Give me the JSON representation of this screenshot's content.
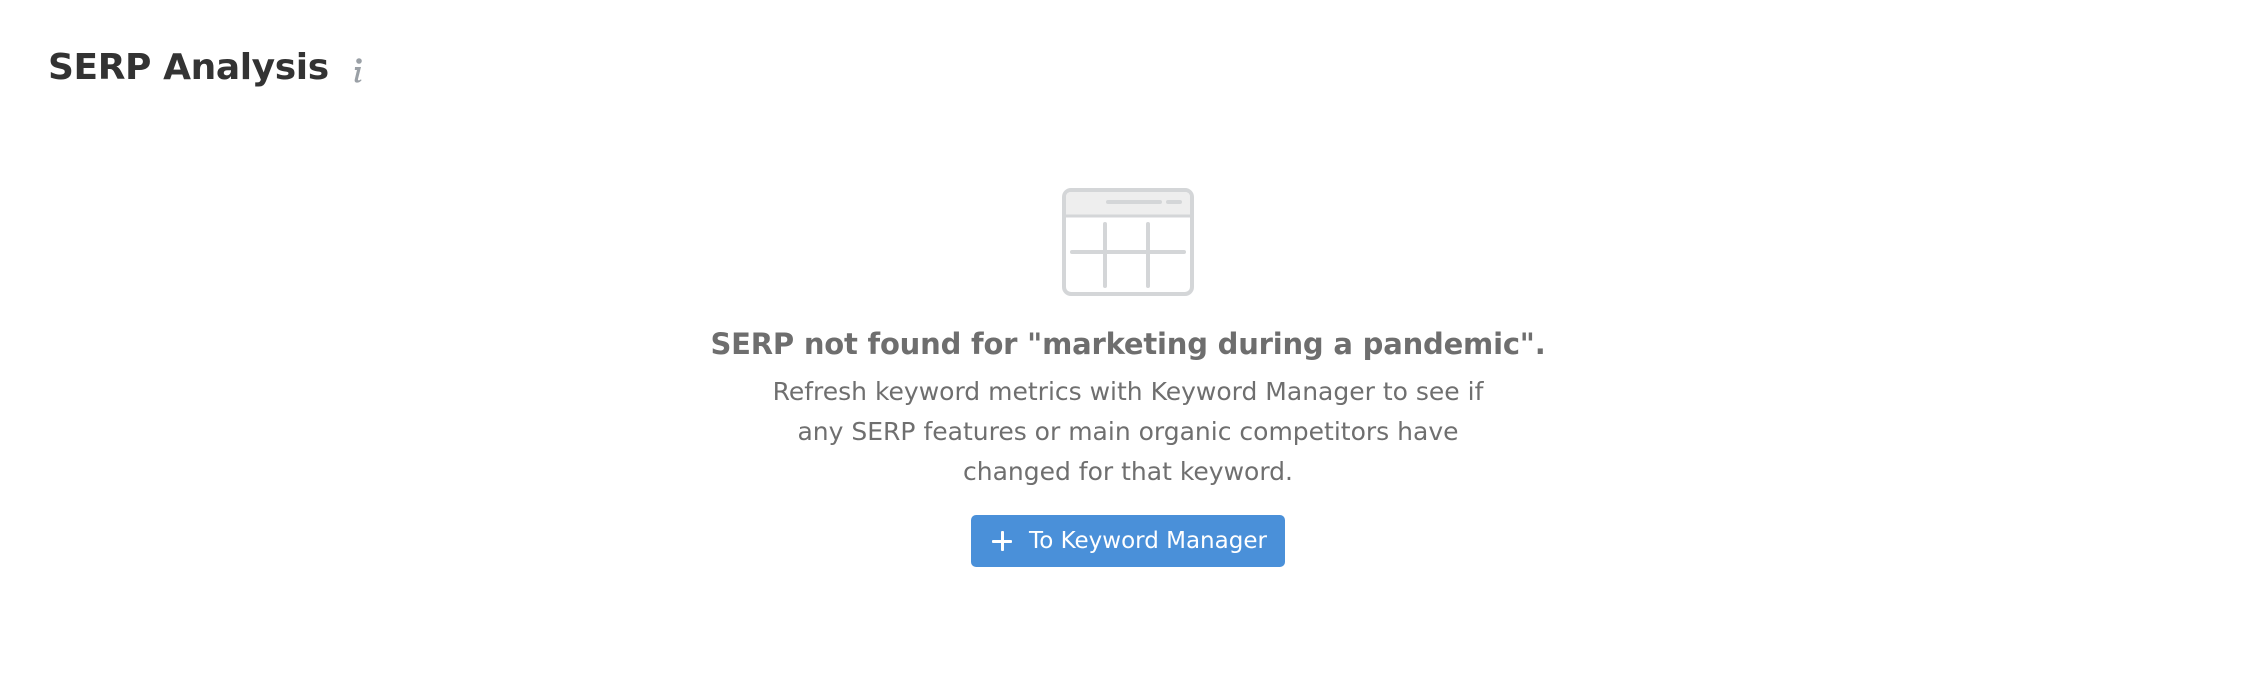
{
  "header": {
    "title": "SERP Analysis",
    "info_icon": "info-icon"
  },
  "empty_state": {
    "illustration_icon": "empty-table-icon",
    "title": "SERP not found for \"marketing during a pandemic\".",
    "description": "Refresh keyword metrics with Keyword Manager to see if any SERP features or main organic competitors have changed for that keyword.",
    "button_label": "To Keyword Manager",
    "button_icon": "plus-icon"
  },
  "colors": {
    "title_text": "#333333",
    "body_text": "#6f6f6f",
    "button_background": "#4a90d9",
    "illustration": "#d4d6d8"
  }
}
